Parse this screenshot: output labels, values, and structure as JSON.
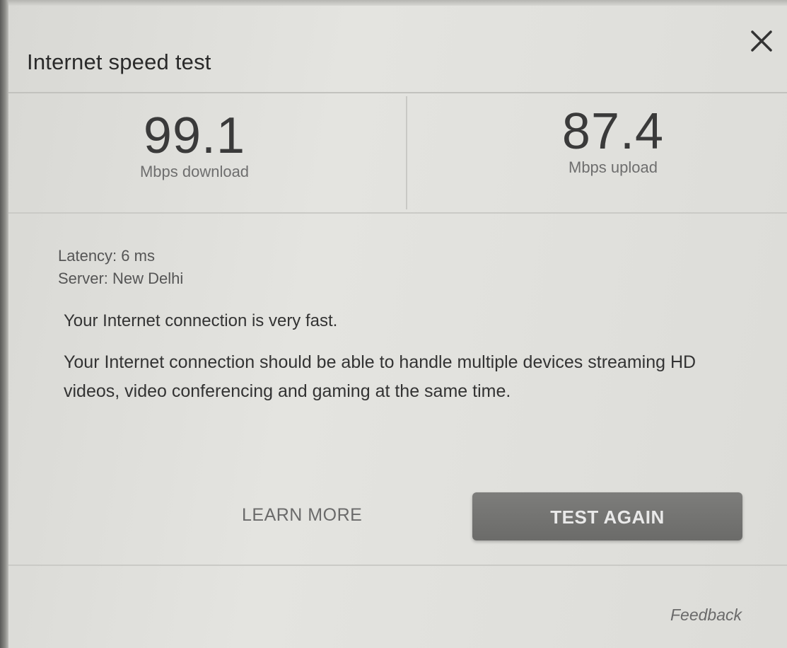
{
  "dialog": {
    "title": "Internet speed test",
    "close_icon": "close-icon"
  },
  "results": {
    "download": {
      "value": "99.1",
      "label": "Mbps download"
    },
    "upload": {
      "value": "87.4",
      "label": "Mbps upload"
    }
  },
  "details": {
    "latency": "Latency: 6 ms",
    "server": "Server: New Delhi"
  },
  "summary": {
    "status": "Your Internet connection is very fast.",
    "description": "Your Internet connection should be able to handle multiple devices streaming HD videos, video conferencing and gaming at the same time."
  },
  "actions": {
    "learn_more": "LEARN MORE",
    "test_again": "TEST AGAIN"
  },
  "footer": {
    "feedback": "Feedback"
  },
  "colors": {
    "background": "#dcdcd8",
    "button": "#757573",
    "text": "#333333"
  }
}
